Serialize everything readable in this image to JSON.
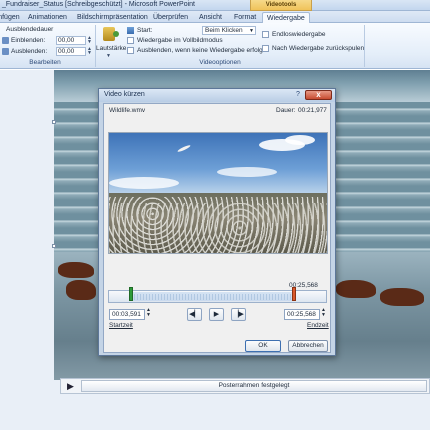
{
  "window": {
    "title": "_Fundraiser_Status [Schreibgeschützt] - Microsoft PowerPoint",
    "context_tab": "Videotools"
  },
  "ribbon": {
    "tabs": [
      "Einfügen",
      "Animationen",
      "Bildschirmpräsentation",
      "Überprüfen",
      "Ansicht",
      "Format",
      "Wiedergabe"
    ],
    "active_tab": "Wiedergabe",
    "bearbeiten": {
      "fade_title": "Ausblendedauer",
      "fade_in_label": "Einblenden:",
      "fade_in_value": "00,00",
      "fade_out_label": "Ausblenden:",
      "fade_out_value": "00,00",
      "group_label": "Bearbeiten"
    },
    "videooptionen": {
      "volume_label": "Lautstärke",
      "start_label": "Start:",
      "start_value": "Beim Klicken",
      "fullscreen_label": "Wiedergabe im Vollbildmodus",
      "hide_label": "Ausblenden, wenn keine Wiedergabe erfolgt",
      "loop_label": "Endloswiedergabe",
      "rewind_label": "Nach Wiedergabe zurückspulen",
      "group_label": "Videooptionen"
    }
  },
  "slide": {
    "poster_status": "Posterrahmen festgelegt"
  },
  "dialog": {
    "title": "Video kürzen",
    "help_icon": "?",
    "close_icon": "x",
    "file_name": "Wildlife.wmv",
    "duration_label": "Dauer:",
    "duration_value": "00:21,977",
    "end_marker_time": "00:25,568",
    "start_time_value": "00:03,591",
    "start_time_label": "Startzeit",
    "end_time_value": "00:25,568",
    "end_time_label": "Endzeit",
    "ok_label": "OK",
    "cancel_label": "Abbrechen",
    "accent_start": "#2e9b3a",
    "accent_end": "#d9582b"
  }
}
